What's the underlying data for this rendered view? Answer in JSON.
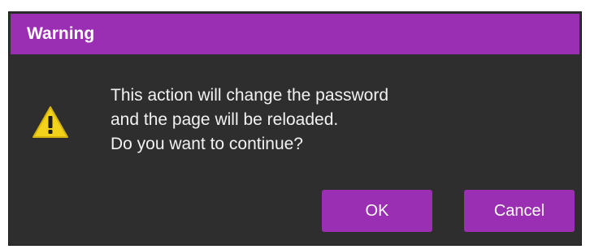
{
  "dialog": {
    "title": "Warning",
    "icon": "warning-triangle-icon",
    "message_lines": [
      "This action will change the password",
      "and the page will be reloaded.",
      "Do you want to continue?"
    ],
    "buttons": {
      "ok_label": "OK",
      "cancel_label": "Cancel"
    }
  },
  "colors": {
    "accent": "#9b2fb4",
    "dialog_background": "#2e2e2e",
    "warning_icon": "#f2d21b",
    "text": "#f2f2f2"
  }
}
